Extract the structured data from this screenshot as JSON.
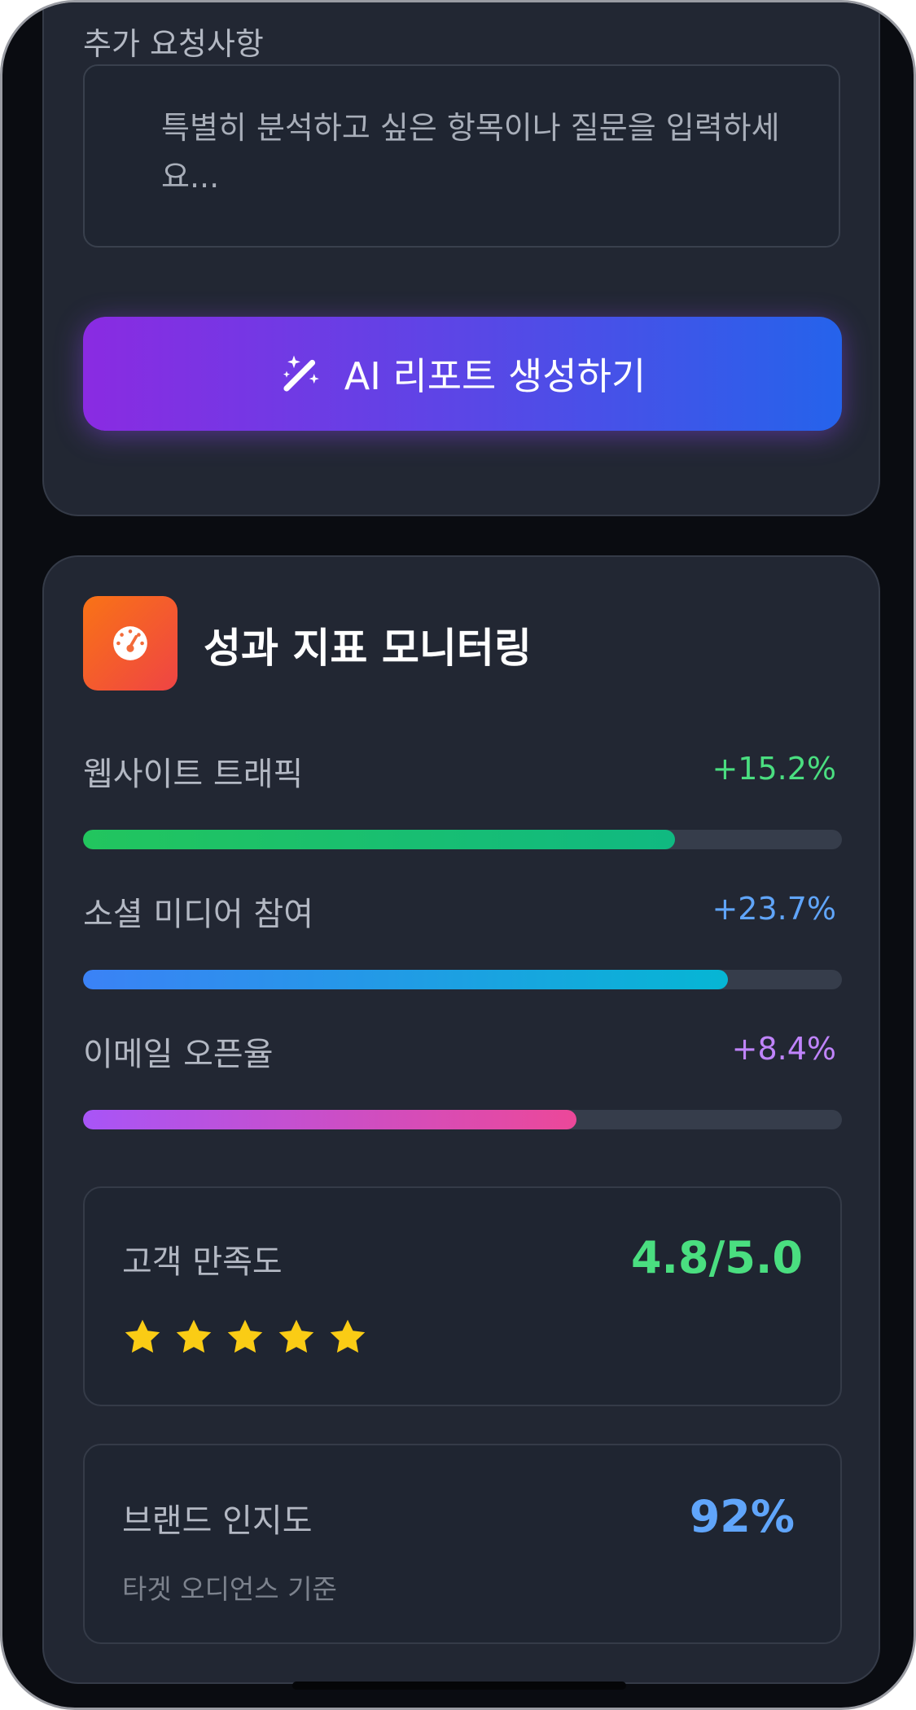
{
  "request": {
    "label": "추가 요청사항",
    "placeholder": "특별히 분석하고 싶은 항목이나 질문을 입력하세요...",
    "generate_button": "AI 리포트 생성하기",
    "generate_icon": "magic-wand-sparkles-icon"
  },
  "metrics_card": {
    "title": "성과 지표 모니터링",
    "icon": "gauge-icon",
    "metrics": [
      {
        "label": "웹사이트 트래픽",
        "value": "+15.2%",
        "progress": 0.78,
        "color": "#4ade80",
        "gradient": [
          "#22c55e",
          "#10b981"
        ]
      },
      {
        "label": "소셜 미디어 참여",
        "value": "+23.7%",
        "progress": 0.85,
        "color": "#60a5fa",
        "gradient": [
          "#3b82f6",
          "#06b6d4"
        ]
      },
      {
        "label": "이메일 오픈율",
        "value": "+8.4%",
        "progress": 0.65,
        "color": "#c084fc",
        "gradient": [
          "#a855f7",
          "#ec4899"
        ]
      }
    ],
    "satisfaction": {
      "label": "고객 만족도",
      "value": "4.8/5.0",
      "stars": 5,
      "color": "#4ade80",
      "star_color": "#facc15"
    },
    "brand": {
      "label": "브랜드 인지도",
      "value": "92%",
      "note": "타겟 오디언스 기준",
      "color": "#60a5fa"
    }
  }
}
